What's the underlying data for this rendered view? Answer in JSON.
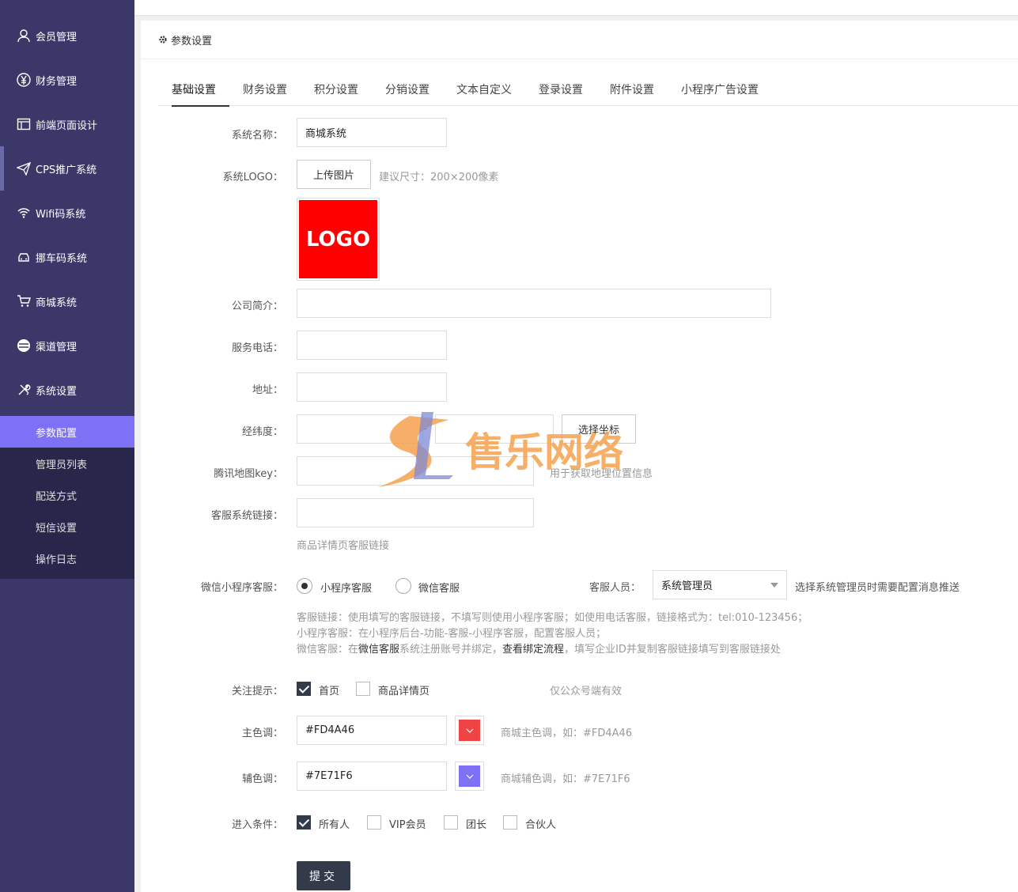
{
  "sidebar": {
    "items": [
      {
        "label": "会员管理",
        "icon": "user-icon"
      },
      {
        "label": "财务管理",
        "icon": "yen-icon"
      },
      {
        "label": "前端页面设计",
        "icon": "layout-icon"
      },
      {
        "label": "CPS推广系统",
        "icon": "paper-plane-icon"
      },
      {
        "label": "Wifi码系统",
        "icon": "wifi-icon"
      },
      {
        "label": "挪车码系统",
        "icon": "car-icon"
      },
      {
        "label": "商城系统",
        "icon": "cart-icon"
      },
      {
        "label": "渠道管理",
        "icon": "channel-icon"
      },
      {
        "label": "系统设置",
        "icon": "tools-icon"
      }
    ],
    "submenu": [
      "参数配置",
      "管理员列表",
      "配送方式",
      "短信设置",
      "操作日志"
    ]
  },
  "panel": {
    "title": "参数设置",
    "tabs": [
      "基础设置",
      "财务设置",
      "积分设置",
      "分销设置",
      "文本自定义",
      "登录设置",
      "附件设置",
      "小程序广告设置"
    ]
  },
  "form": {
    "system_name": {
      "label": "系统名称：",
      "value": "商城系统"
    },
    "logo": {
      "label": "系统LOGO：",
      "button": "上传图片",
      "hint": "建议尺寸：200×200像素",
      "preview_text": "LOGO"
    },
    "intro": {
      "label": "公司简介："
    },
    "phone": {
      "label": "服务电话："
    },
    "address": {
      "label": "地址："
    },
    "coords": {
      "label": "经纬度：",
      "button": "选择坐标",
      "separator": "-"
    },
    "map_key": {
      "label": "腾讯地图key：",
      "hint": "用于获取地理位置信息"
    },
    "service_link": {
      "label": "客服系统链接：",
      "hint": "商品详情页客服链接"
    },
    "wx_service": {
      "label": "微信小程序客服：",
      "options": [
        "小程序客服",
        "微信客服"
      ],
      "staff_label": "客服人员：",
      "staff_value": "系统管理员",
      "staff_hint": "选择系统管理员时需要配置消息推送",
      "note1": "客服链接：使用填写的客服链接，不填写则使用小程序客服；如使用电话客服，链接格式为：tel:010-123456；",
      "note2": "小程序客服：在小程序后台-功能-客服-小程序客服，配置客服人员；",
      "note3_a": "微信客服：在",
      "note3_link1": "微信客服",
      "note3_b": "系统注册账号并绑定，",
      "note3_link2": "查看绑定流程",
      "note3_c": "，填写企业ID并复制客服链接填写到客服链接处"
    },
    "follow": {
      "label": "关注提示：",
      "options": [
        "首页",
        "商品详情页"
      ],
      "hint": "仅公众号端有效"
    },
    "primary_color": {
      "label": "主色调：",
      "value": "#FD4A46",
      "hint": "商城主色调，如：#FD4A46",
      "swatch": "#f04444"
    },
    "secondary_color": {
      "label": "辅色调：",
      "value": "#7E71F6",
      "hint": "商城辅色调，如：#7E71F6",
      "swatch": "#7e71f6"
    },
    "entry": {
      "label": "进入条件：",
      "options": [
        "所有人",
        "VIP会员",
        "团长",
        "合伙人"
      ]
    },
    "submit": "提交"
  },
  "watermark": "售乐网络"
}
